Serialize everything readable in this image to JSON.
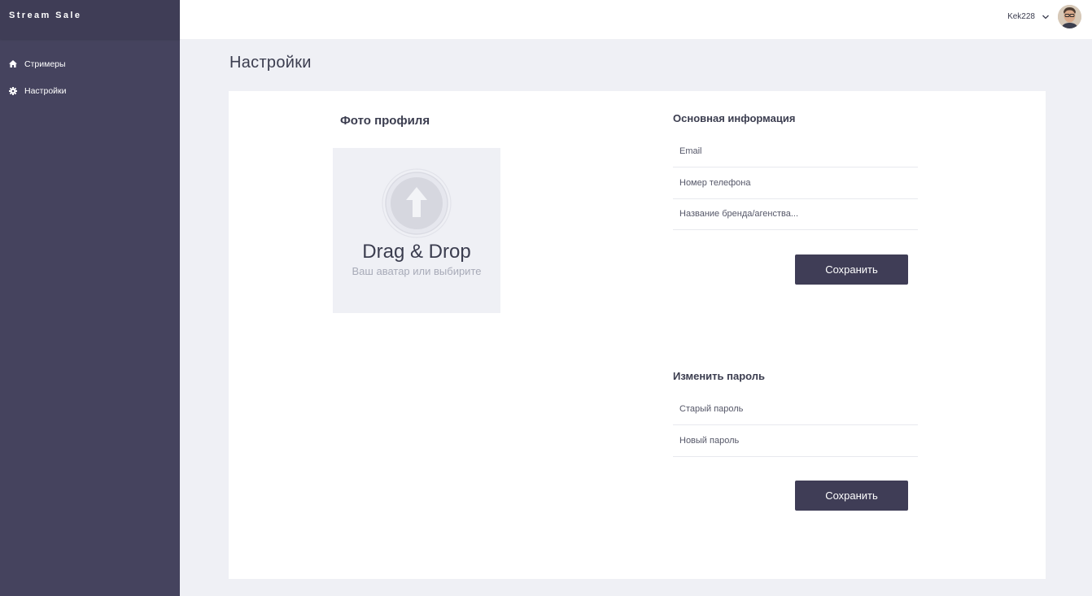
{
  "app": {
    "brand": "Stream Sale"
  },
  "sidebar": {
    "items": [
      {
        "label": "Стримеры",
        "icon": "home-icon"
      },
      {
        "label": "Настройки",
        "icon": "gear-icon"
      }
    ]
  },
  "header": {
    "username": "Kek228"
  },
  "page": {
    "title": "Настройки"
  },
  "photo": {
    "title": "Фото профиля",
    "dropzone_title": "Drag & Drop",
    "dropzone_subtitle": "Ваш аватар или выбирите"
  },
  "basic_info": {
    "title": "Основная информация",
    "email_placeholder": "Email",
    "phone_placeholder": "Номер телефона",
    "brand_placeholder": "Название бренда/агенства...",
    "save_label": "Сохранить"
  },
  "password": {
    "title": "Изменить пароль",
    "old_placeholder": "Старый пароль",
    "new_placeholder": "Новый пароль",
    "save_label": "Сохранить"
  },
  "colors": {
    "sidebar_bg": "#45435e",
    "brand_bg": "#3f3d56",
    "page_bg": "#eff0f5",
    "button_bg": "#3f3d56",
    "text": "#3b3d4f"
  }
}
